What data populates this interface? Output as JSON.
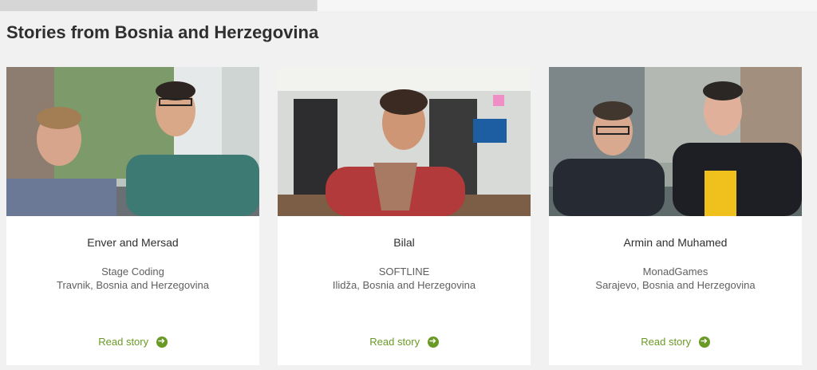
{
  "section": {
    "title": "Stories from Bosnia and Herzegovina"
  },
  "stories": [
    {
      "name": "Enver and Mersad",
      "company": "Stage Coding",
      "location": "Travnik, Bosnia and Herzegovina",
      "link": "Read story"
    },
    {
      "name": "Bilal",
      "company": "SOFTLINE",
      "location": "Ilidža, Bosnia and Herzegovina",
      "link": "Read story"
    },
    {
      "name": "Armin and Muhamed",
      "company": "MonadGames",
      "location": "Sarajevo, Bosnia and Herzegovina",
      "link": "Read story"
    }
  ],
  "colors": {
    "link": "#6a9a26",
    "background": "#f1f1f1",
    "card": "#ffffff"
  }
}
